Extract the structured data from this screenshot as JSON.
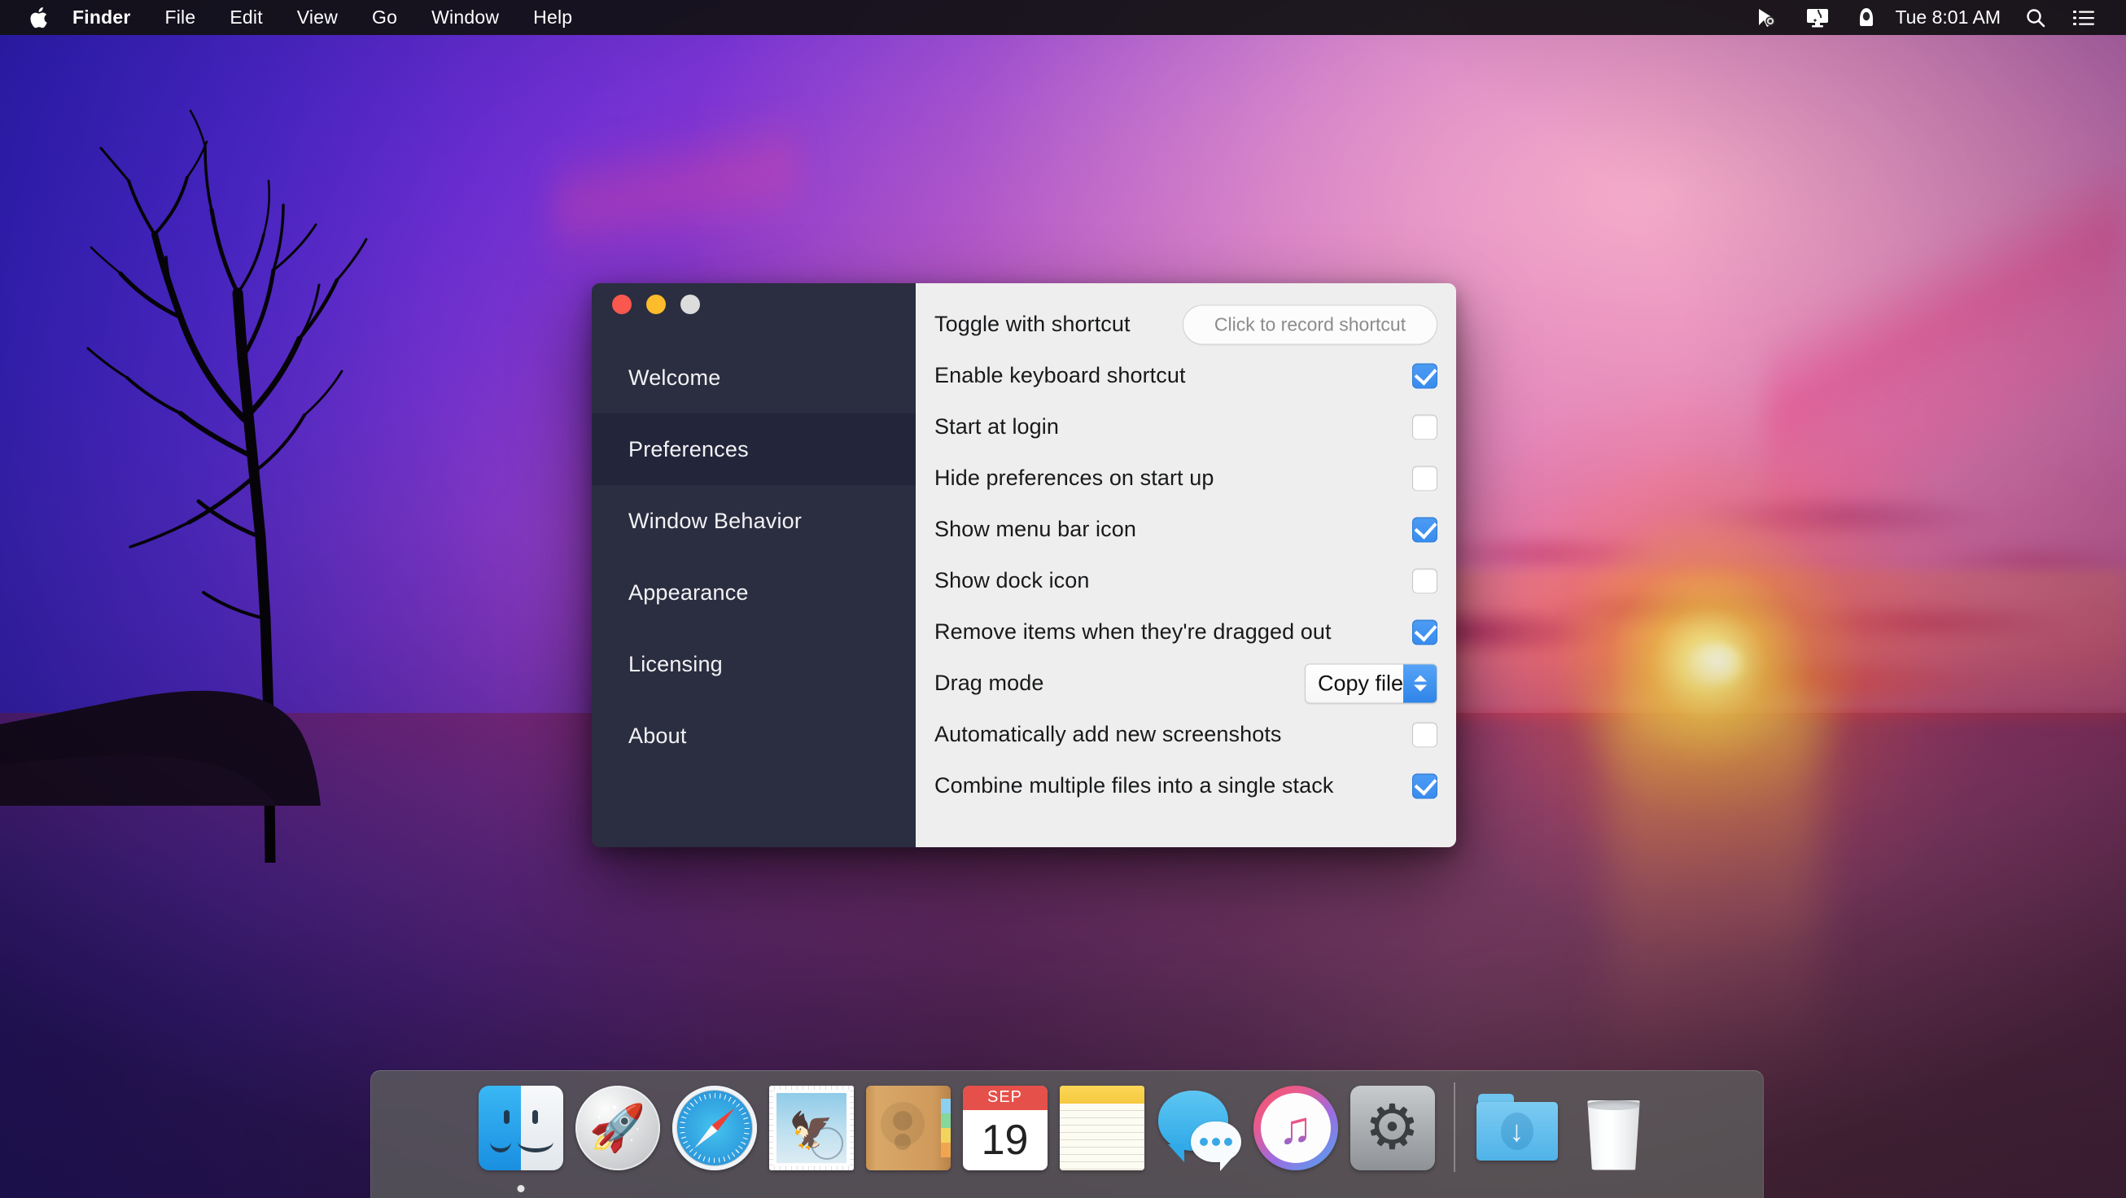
{
  "menubar": {
    "apple_icon": "apple-logo-icon",
    "items": [
      {
        "label": "Finder",
        "bold": true
      },
      {
        "label": "File",
        "bold": false
      },
      {
        "label": "Edit",
        "bold": false
      },
      {
        "label": "View",
        "bold": false
      },
      {
        "label": "Go",
        "bold": false
      },
      {
        "label": "Window",
        "bold": false
      },
      {
        "label": "Help",
        "bold": false
      }
    ],
    "status_icons": [
      "cursor-pointer-icon",
      "display-screenshot-icon",
      "bartender-icon"
    ],
    "clock": "Tue 8:01 AM",
    "search_icon": "search-icon",
    "notification_center_icon": "notification-center-icon"
  },
  "window": {
    "traffic_lights": [
      "close",
      "minimize",
      "zoom"
    ],
    "sidebar": {
      "items": [
        {
          "label": "Welcome",
          "active": false
        },
        {
          "label": "Preferences",
          "active": true
        },
        {
          "label": "Window Behavior",
          "active": false
        },
        {
          "label": "Appearance",
          "active": false
        },
        {
          "label": "Licensing",
          "active": false
        },
        {
          "label": "About",
          "active": false
        }
      ]
    },
    "preferences": {
      "rows": [
        {
          "label": "Toggle with shortcut",
          "control": "button",
          "value": "Click to record shortcut"
        },
        {
          "label": "Enable keyboard shortcut",
          "control": "checkbox",
          "checked": true
        },
        {
          "label": "Start at login",
          "control": "checkbox",
          "checked": false
        },
        {
          "label": "Hide preferences on start up",
          "control": "checkbox",
          "checked": false
        },
        {
          "label": "Show menu bar icon",
          "control": "checkbox",
          "checked": true
        },
        {
          "label": "Show dock icon",
          "control": "checkbox",
          "checked": false
        },
        {
          "label": "Remove items when they're dragged out",
          "control": "checkbox",
          "checked": true
        },
        {
          "label": "Drag mode",
          "control": "popup",
          "value": "Copy files"
        },
        {
          "label": "Automatically add new screenshots",
          "control": "checkbox",
          "checked": false
        },
        {
          "label": "Combine multiple files into a single stack",
          "control": "checkbox",
          "checked": true
        }
      ]
    }
  },
  "dock": {
    "items": [
      {
        "name": "Finder",
        "icon": "finder-icon",
        "running": true
      },
      {
        "name": "Launchpad",
        "icon": "launchpad-icon",
        "running": false
      },
      {
        "name": "Safari",
        "icon": "safari-icon",
        "running": false
      },
      {
        "name": "Mail",
        "icon": "mail-icon",
        "running": false
      },
      {
        "name": "Contacts",
        "icon": "contacts-icon",
        "running": false
      },
      {
        "name": "Calendar",
        "icon": "calendar-icon",
        "running": false,
        "month": "SEP",
        "day": "19"
      },
      {
        "name": "Notes",
        "icon": "notes-icon",
        "running": false
      },
      {
        "name": "Messages",
        "icon": "messages-icon",
        "running": false
      },
      {
        "name": "iTunes",
        "icon": "itunes-icon",
        "running": false
      },
      {
        "name": "System Preferences",
        "icon": "system-preferences-icon",
        "running": false
      }
    ],
    "right_items": [
      {
        "name": "Downloads",
        "icon": "downloads-folder-icon"
      },
      {
        "name": "Trash",
        "icon": "trash-icon"
      }
    ]
  },
  "colors": {
    "accent_blue": "#3a8ced",
    "sidebar_bg": "#2b2d40",
    "sidebar_active_bg": "#23253a",
    "panel_bg": "#eeeeee",
    "menubar_bg": "#121114",
    "traffic_red": "#f9584f",
    "traffic_yellow": "#fcbc2b",
    "traffic_green": "#dcdcdc"
  }
}
